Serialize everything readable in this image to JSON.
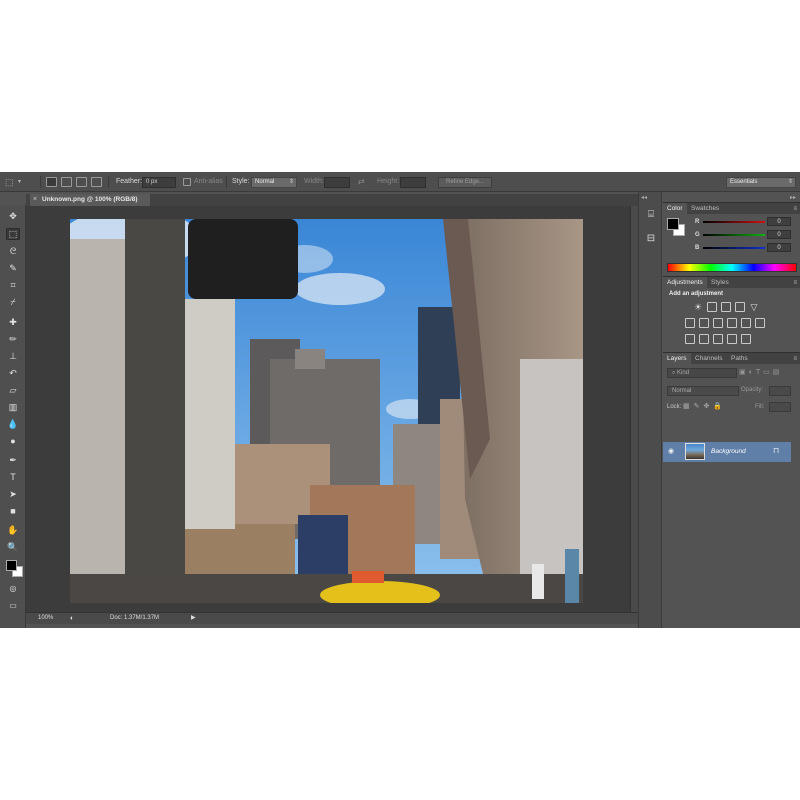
{
  "options_bar": {
    "feather_label": "Feather:",
    "feather_value": "0 px",
    "antialias_label": "Anti-alias",
    "style_label": "Style:",
    "style_value": "Normal",
    "width_label": "Width:",
    "height_label": "Height:",
    "refine_edge_label": "Refine Edge...",
    "workspace_value": "Essentials"
  },
  "document": {
    "tab_title": "Unknown.png @ 100% (RGB/8)",
    "zoom": "100%",
    "doc_size": "Doc: 1.37M/1.37M"
  },
  "color_panel": {
    "tabs": [
      "Color",
      "Swatches"
    ],
    "channels": [
      {
        "label": "R",
        "value": "0",
        "color": "#d01010"
      },
      {
        "label": "G",
        "value": "0",
        "color": "#10b010"
      },
      {
        "label": "B",
        "value": "0",
        "color": "#1030d0"
      }
    ]
  },
  "adjustments_panel": {
    "tabs": [
      "Adjustments",
      "Styles"
    ],
    "heading": "Add an adjustment"
  },
  "layers_panel": {
    "tabs": [
      "Layers",
      "Channels",
      "Paths"
    ],
    "filter_value": "Kind",
    "blend_mode": "Normal",
    "opacity_label": "Opacity:",
    "lock_label": "Lock:",
    "fill_label": "Fill:",
    "layers": [
      {
        "name": "Background",
        "visible": true,
        "locked": true
      }
    ]
  },
  "colors": {
    "app_bg": "#535353",
    "panel_dark": "#424242",
    "layer_selected": "#5f7fa8",
    "foreground": "#000000",
    "background": "#ffffff"
  }
}
